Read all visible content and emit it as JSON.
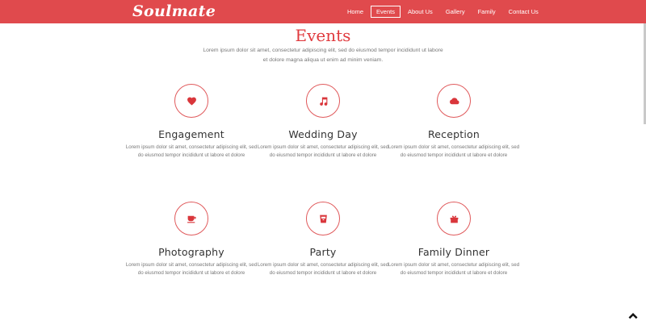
{
  "brand": "Soulmate",
  "nav": {
    "items": [
      "Home",
      "Events",
      "About Us",
      "Gallery",
      "Family",
      "Contact Us"
    ],
    "active": "Events"
  },
  "section": {
    "title": "Events",
    "description": "Lorem ipsum dolor sit amet, consectetur adipiscing elit, sed do eiusmod tempor incididunt ut labore et dolore magna aliqua ut enim ad minim veniam."
  },
  "events": [
    {
      "title": "Engagement",
      "icon": "heart-icon",
      "text": "Lorem ipsum dolor sit amet, consectetur adipiscing elit, sed do eiusmod tempor incididunt ut labore et dolore"
    },
    {
      "title": "Wedding Day",
      "icon": "music-note-icon",
      "text": "Lorem ipsum dolor sit amet, consectetur adipiscing elit, sed do eiusmod tempor incididunt ut labore et dolore"
    },
    {
      "title": "Reception",
      "icon": "cloud-icon",
      "text": "Lorem ipsum dolor sit amet, consectetur adipiscing elit, sed do eiusmod tempor incididunt ut labore et dolore"
    },
    {
      "title": "Photography",
      "icon": "cup-icon",
      "text": "Lorem ipsum dolor sit amet, consectetur adipiscing elit, sed do eiusmod tempor incididunt ut labore et dolore"
    },
    {
      "title": "Party",
      "icon": "drink-icon",
      "text": "Lorem ipsum dolor sit amet, consectetur adipiscing elit, sed do eiusmod tempor incididunt ut labore et dolore"
    },
    {
      "title": "Family Dinner",
      "icon": "gift-icon",
      "text": "Lorem ipsum dolor sit amet, consectetur adipiscing elit, sed do eiusmod tempor incididunt ut labore et dolore"
    }
  ],
  "colors": {
    "accent": "#e04a4d",
    "title": "#e03a3e",
    "text": "#777777"
  },
  "back_to_top_icon": "chevron-up-icon"
}
